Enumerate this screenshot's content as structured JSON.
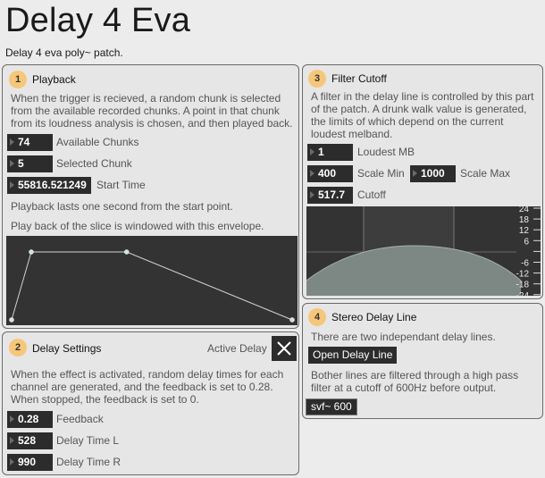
{
  "title": "Delay 4 Eva",
  "subtitle": "Delay 4 eva poly~ patch.",
  "playback": {
    "number": "1",
    "title": "Playback",
    "description": [
      "When the trigger is recieved, a random chunk is selected",
      "from the available recorded chunks. A point in that chunk",
      "from its loudness analysis is chosen, and then played back."
    ],
    "available_chunks": {
      "value": "74",
      "label": "Available Chunks"
    },
    "selected_chunk": {
      "value": "5",
      "label": "Selected Chunk"
    },
    "start_time": {
      "value": "55816.521249",
      "label": "Start Time"
    },
    "note1": "Playback lasts one second from the start point.",
    "note2": "Play back of the slice is windowed with this envelope.",
    "envelope_points": [
      [
        0,
        0
      ],
      [
        0.07,
        1
      ],
      [
        0.41,
        1
      ],
      [
        1,
        0
      ]
    ]
  },
  "delay_settings": {
    "number": "2",
    "title": "Delay Settings",
    "active_label": "Active Delay",
    "active": true,
    "description": [
      "When the effect is activated, random delay times for each",
      "channel are generated, and the feedback is set to 0.28.",
      "When stopped, the feedback is set to 0."
    ],
    "feedback": {
      "value": "0.28",
      "label": "Feedback"
    },
    "delay_l": {
      "value": "528",
      "label": "Delay Time L"
    },
    "delay_r": {
      "value": "990",
      "label": "Delay Time R"
    }
  },
  "filter_cutoff": {
    "number": "3",
    "title": "Filter Cutoff",
    "description": [
      "A filter in the delay line is controlled by this part",
      "of the patch. A drunk walk value is generated,",
      "the limits of which depend on the current",
      "loudest melband."
    ],
    "loudest_mb": {
      "value": "1",
      "label": "Loudest MB"
    },
    "scale_min": {
      "value": "400",
      "label": "Scale Min"
    },
    "scale_max": {
      "value": "1000",
      "label": "Scale Max"
    },
    "cutoff": {
      "value": "517.7",
      "label": "Cutoff"
    },
    "db_ticks": [
      "24",
      "18",
      "12",
      "6",
      "",
      "-6",
      "-12",
      "-18",
      "-24"
    ]
  },
  "stereo_delay": {
    "number": "4",
    "title": "Stereo Delay Line",
    "description1": "There are two independant delay lines.",
    "open_button": "Open Delay Line",
    "description2": [
      "Bother lines are filtered through a high pass",
      "filter at a cutoff of 600Hz before output."
    ],
    "object_label": "svf~ 600"
  }
}
